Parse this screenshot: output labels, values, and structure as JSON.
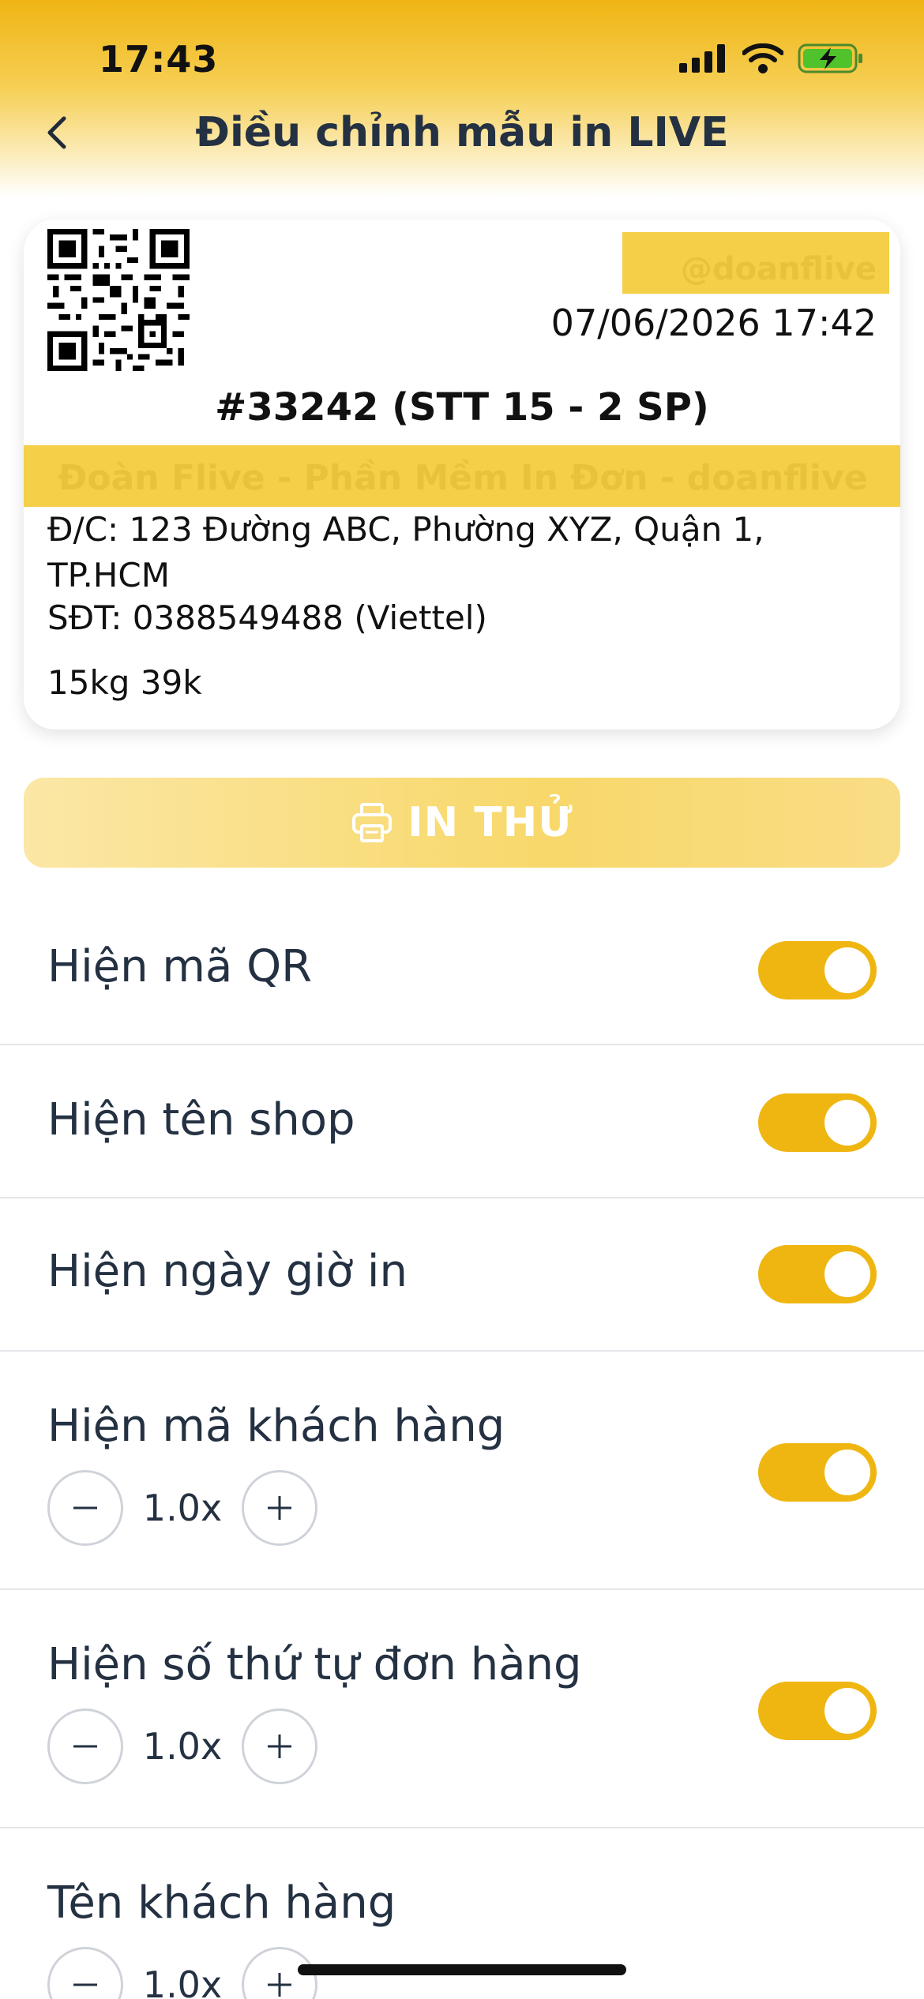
{
  "status_bar": {
    "time": "17:43"
  },
  "header": {
    "title": "Điều chỉnh mẫu in LIVE"
  },
  "preview": {
    "shop_name": "@doanflive",
    "print_datetime": "07/06/2026 17:42",
    "order_line": "#33242  (STT 15 - 2 SP)",
    "customer_band": "Đoàn Flive - Phần Mềm In Đơn - doanflive",
    "address": "Đ/C: 123 Đường ABC, Phường XYZ, Quận 1, TP.HCM",
    "phone": "SĐT: 0388549488 (Viettel)",
    "weight_price": "15kg 39k"
  },
  "test_print": {
    "label": "IN THỬ"
  },
  "settings": [
    {
      "label": "Hiện mã QR",
      "enabled": true
    },
    {
      "label": "Hiện tên shop",
      "enabled": true
    },
    {
      "label": "Hiện ngày giờ in",
      "enabled": true
    },
    {
      "label": "Hiện mã khách hàng",
      "enabled": true,
      "scale": "1.0x"
    },
    {
      "label": "Hiện số thứ tự đơn hàng",
      "enabled": true,
      "scale": "1.0x"
    },
    {
      "label": "Tên khách hàng",
      "scale": "1.0x"
    }
  ],
  "colors": {
    "accent": "#efb612",
    "highlight": "#f4cf47",
    "text": "#243142"
  },
  "icons": {
    "back": "chevron-left-icon",
    "print": "printer-icon",
    "minus": "minus-icon",
    "plus": "plus-icon"
  }
}
